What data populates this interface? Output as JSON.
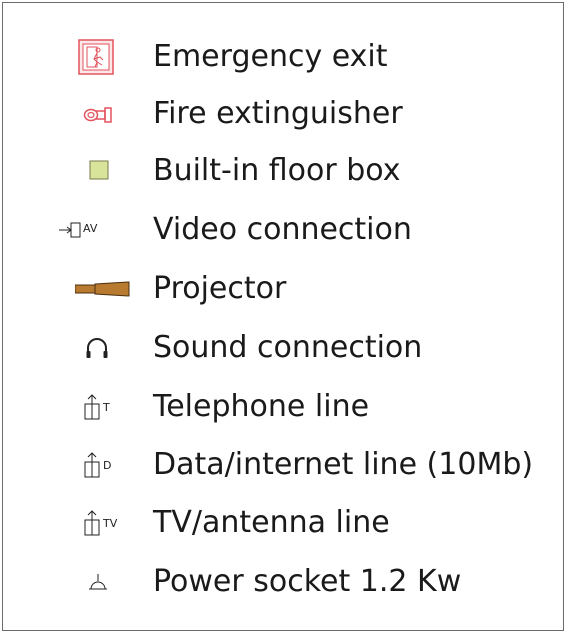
{
  "legend": {
    "items": [
      {
        "icon": "emergency-exit-icon",
        "label": "Emergency exit",
        "color": "#e2535e"
      },
      {
        "icon": "fire-extinguisher-icon",
        "label": "Fire extinguisher",
        "color": "#e2535e"
      },
      {
        "icon": "floor-box-icon",
        "label": "Built-in floor box",
        "color": "#d8e49a"
      },
      {
        "icon": "video-connection-icon",
        "label": "Video connection",
        "sub": "AV"
      },
      {
        "icon": "projector-icon",
        "label": "Projector",
        "color": "#b87a2e"
      },
      {
        "icon": "headphones-icon",
        "label": "Sound connection"
      },
      {
        "icon": "telephone-line-icon",
        "label": "Telephone line",
        "sub": "T"
      },
      {
        "icon": "data-line-icon",
        "label": "Data/internet line (10Mb)",
        "sub": "D"
      },
      {
        "icon": "antenna-line-icon",
        "label": "TV/antenna line",
        "sub": "TV"
      },
      {
        "icon": "power-socket-icon",
        "label": "Power socket 1.2 Kw"
      }
    ]
  }
}
